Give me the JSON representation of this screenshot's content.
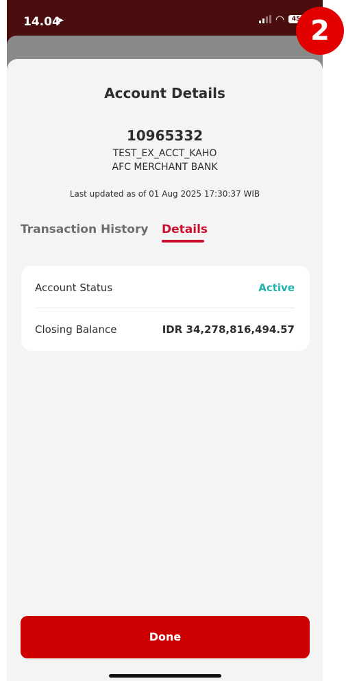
{
  "status_bar": {
    "time": "14.04",
    "battery": "45"
  },
  "page": {
    "title": "Account Details",
    "account_number": "10965332",
    "account_name": "TEST_EX_ACCT_KAHO",
    "bank_name": "AFC MERCHANT BANK",
    "last_updated": "Last updated as of 01 Aug 2025 17:30:37 WIB"
  },
  "tabs": [
    {
      "label": "Transaction History",
      "active": false
    },
    {
      "label": "Details",
      "active": true
    }
  ],
  "details": [
    {
      "label": "Account Status",
      "value": "Active",
      "value_color": "#22b3ad"
    },
    {
      "label": "Closing Balance",
      "value": "IDR 34,278,816,494.57"
    }
  ],
  "done_button": {
    "label": "Done"
  },
  "step_badge": {
    "number": "2"
  },
  "colors": {
    "accent": "#c8102e",
    "button": "#cc0000",
    "active_status": "#22b3ad"
  }
}
